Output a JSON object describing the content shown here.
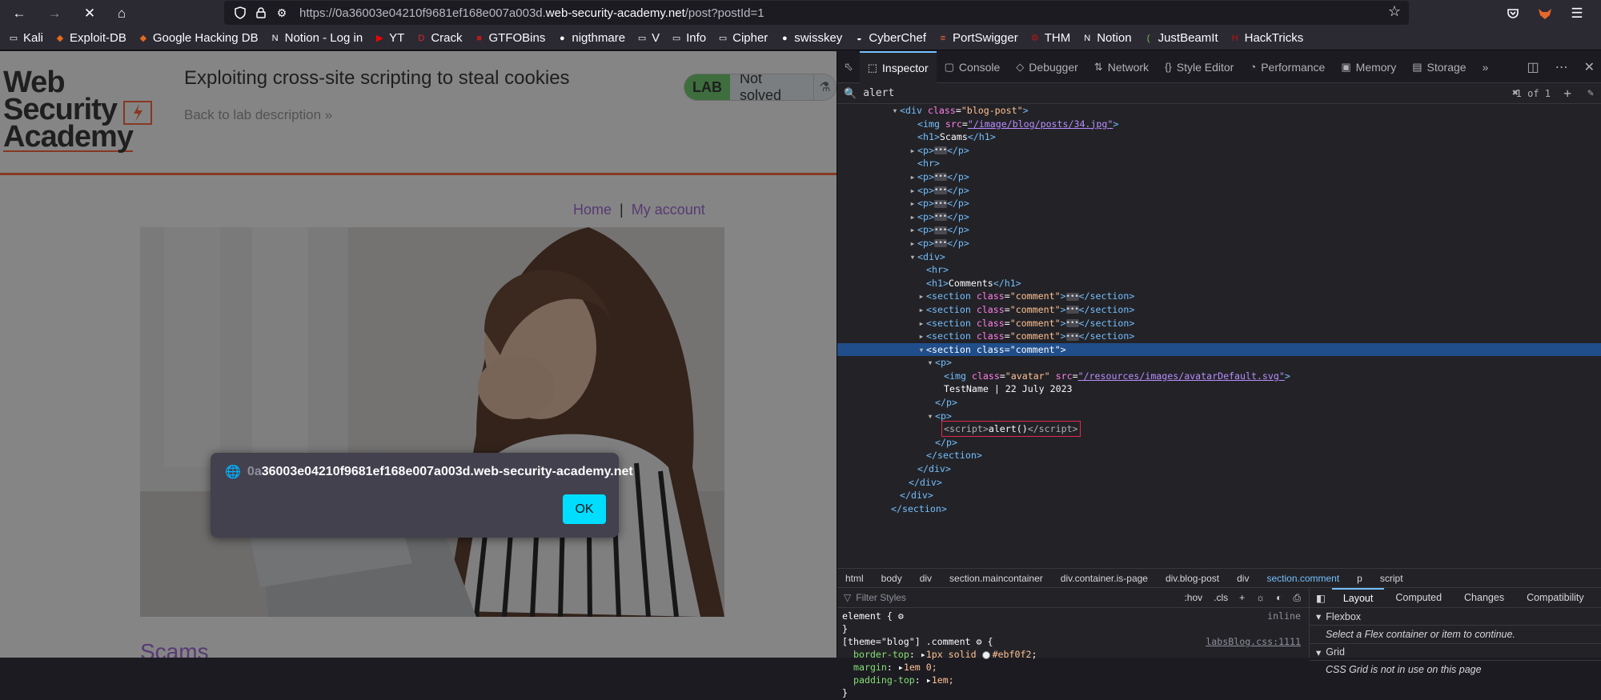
{
  "browser": {
    "url_prefix": "https://0a36003e04210f9681ef168e007a003d.",
    "url_host": "web-security-academy.net",
    "url_path": "/post?postId=1",
    "bookmarks": [
      {
        "label": "Kali",
        "icon": "folder-icon",
        "color": "#fbfbfe"
      },
      {
        "label": "Exploit-DB",
        "icon": "exploitdb-icon",
        "color": "#e56a1c"
      },
      {
        "label": "Google Hacking DB",
        "icon": "ghdb-icon",
        "color": "#e56a1c"
      },
      {
        "label": "Notion - Log in",
        "icon": "notion-icon",
        "color": "#ffffff"
      },
      {
        "label": "YT",
        "icon": "youtube-icon",
        "color": "#ff0000"
      },
      {
        "label": "Crack",
        "icon": "crack-icon",
        "color": "#e0262c"
      },
      {
        "label": "GTFOBins",
        "icon": "gtfobins-icon",
        "color": "#b71c1c"
      },
      {
        "label": "nigthmare",
        "icon": "github-icon",
        "color": "#ffffff"
      },
      {
        "label": "V",
        "icon": "folder-icon",
        "color": "#fbfbfe"
      },
      {
        "label": "Info",
        "icon": "folder-icon",
        "color": "#fbfbfe"
      },
      {
        "label": "Cipher",
        "icon": "folder-icon",
        "color": "#fbfbfe"
      },
      {
        "label": "swisskey",
        "icon": "github-icon",
        "color": "#ffffff"
      },
      {
        "label": "CyberChef",
        "icon": "cyberchef-icon",
        "color": "#ffffff"
      },
      {
        "label": "PortSwigger",
        "icon": "portswigger-icon",
        "color": "#ff6633"
      },
      {
        "label": "THM",
        "icon": "thm-icon",
        "color": "#c11111"
      },
      {
        "label": "Notion",
        "icon": "notion-icon",
        "color": "#ffffff"
      },
      {
        "label": "JustBeamIt",
        "icon": "justbeamit-icon",
        "color": "#7cc242"
      },
      {
        "label": "HackTricks",
        "icon": "hacktricks-icon",
        "color": "#c11111"
      }
    ]
  },
  "page": {
    "logo_line1": "Web Security",
    "logo_line2": "Academy",
    "lab_title": "Exploiting cross-site scripting to steal cookies",
    "back_link": "Back to lab description",
    "badge_lab": "LAB",
    "badge_status": "Not solved",
    "nav_home": "Home",
    "nav_sep": "|",
    "nav_account": "My account",
    "post_title": "Scams",
    "accent": "#ff6633"
  },
  "alert": {
    "origin_faded": "0a",
    "origin": "36003e04210f9681ef168e007a003d.web-security-academy.net",
    "ok": "OK"
  },
  "devtools": {
    "tabs": [
      {
        "label": "Inspector",
        "icon": "inspector-icon"
      },
      {
        "label": "Console",
        "icon": "console-icon"
      },
      {
        "label": "Debugger",
        "icon": "debugger-icon"
      },
      {
        "label": "Network",
        "icon": "network-icon"
      },
      {
        "label": "Style Editor",
        "icon": "style-editor-icon"
      },
      {
        "label": "Performance",
        "icon": "performance-icon"
      },
      {
        "label": "Memory",
        "icon": "memory-icon"
      },
      {
        "label": "Storage",
        "icon": "storage-icon"
      }
    ],
    "search_query": "alert",
    "search_count": "1 of 1",
    "breadcrumbs": [
      "html",
      "body",
      "div",
      "section.maincontainer",
      "div.container.is-page",
      "div.blog-post",
      "div",
      "section.comment",
      "p",
      "script"
    ],
    "rules_filter_placeholder": "Filter Styles",
    "rules_hov": ":hov",
    "rules_cls": ".cls",
    "element_rule": "element {",
    "element_rule_src": "inline",
    "comment_selector": "[theme=\"blog\"] .comment",
    "comment_rule_src": "labsBlog.css:1111",
    "comment_props": [
      {
        "name": "border-top",
        "value": "1px solid",
        "color": "#ebf0f2"
      },
      {
        "name": "margin",
        "value": "1em 0;"
      },
      {
        "name": "padding-top",
        "value": "1em;"
      }
    ],
    "layout_tabs": [
      "Layout",
      "Computed",
      "Changes",
      "Compatibility"
    ],
    "flexbox_label": "Flexbox",
    "flexbox_msg": "Select a Flex container or item to continue.",
    "grid_label": "Grid",
    "grid_msg": "CSS Grid is not in use on this page",
    "markup": {
      "blog_post_class": "blog-post",
      "img_src": "/image/blog/posts/34.jpg",
      "h1_scams": "Scams",
      "h1_comments": "Comments",
      "comment_class": "comment",
      "avatar_class": "avatar",
      "avatar_src": "/resources/images/avatarDefault.svg",
      "comment_meta": "TestName | 22 July 2023",
      "script_body": "alert()"
    }
  }
}
